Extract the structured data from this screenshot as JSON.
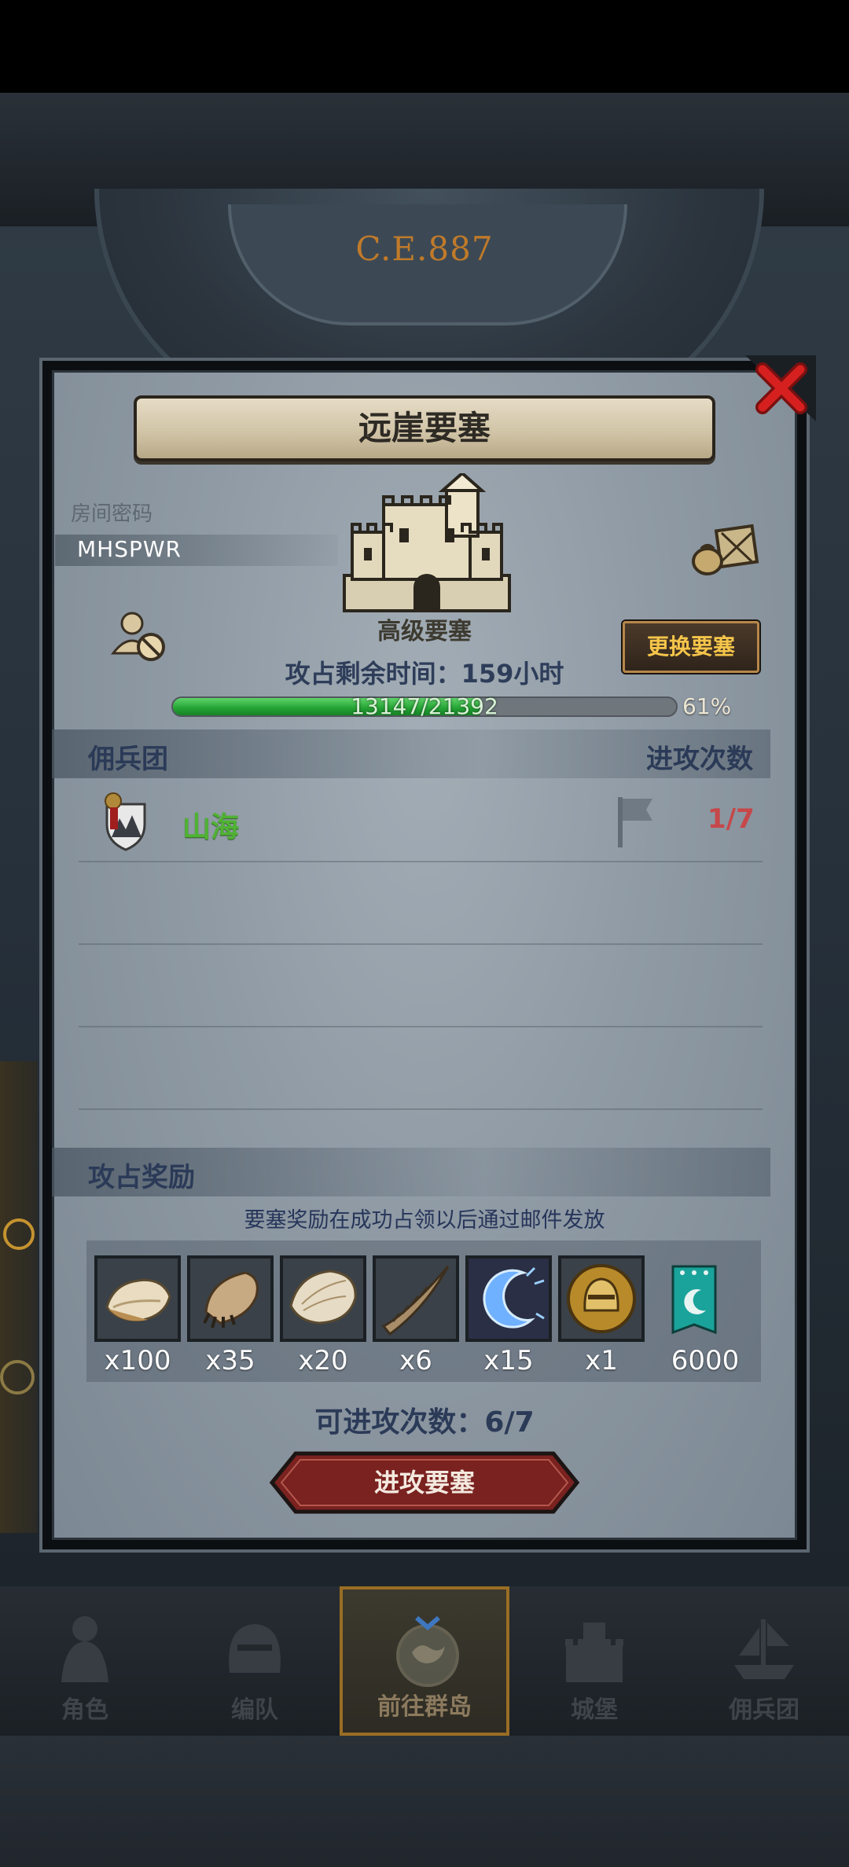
{
  "background": {
    "era_label": "C.E.887"
  },
  "dialog": {
    "title": "远崖要塞",
    "room": {
      "label": "房间密码",
      "code": "MHSPWR"
    },
    "fortress_level": "高级要塞",
    "change_button": "更换要塞",
    "remaining_time": "攻占剩余时间：159小时",
    "progress": {
      "text": "13147/21392",
      "percent_label": "61%",
      "fraction": 0.61
    },
    "mercenary_section": {
      "title": "佣兵团",
      "right_title": "进攻次数"
    },
    "guilds": [
      {
        "name": "山海",
        "attacks": "1/7"
      }
    ],
    "rewards_section": {
      "title": "攻占奖励",
      "note": "要塞奖励在成功占领以后通过邮件发放",
      "items": [
        {
          "icon": "fur-pelt-icon",
          "count": "x100"
        },
        {
          "icon": "claw-pelt-icon",
          "count": "x35"
        },
        {
          "icon": "hide-icon",
          "count": "x20"
        },
        {
          "icon": "horn-icon",
          "count": "x6"
        },
        {
          "icon": "blue-crescent-icon",
          "count": "x15"
        },
        {
          "icon": "golden-helmet-icon",
          "count": "x1"
        },
        {
          "icon": "guild-banner-icon",
          "count": "6000"
        }
      ]
    },
    "attack_quota": "可进攻次数：6/7",
    "attack_button": "进攻要塞"
  },
  "bottom_nav": [
    {
      "label": "角色",
      "icon": "knight-icon",
      "active": false
    },
    {
      "label": "编队",
      "icon": "helmet-icon",
      "active": false
    },
    {
      "label": "前往群岛",
      "icon": "world-map-icon",
      "active": true
    },
    {
      "label": "城堡",
      "icon": "castle-icon",
      "active": false
    },
    {
      "label": "佣兵团",
      "icon": "ship-icon",
      "active": false
    }
  ],
  "colors": {
    "accent_gold": "#f5c54a",
    "progress_green": "#23a233",
    "attack_red": "#c6484a",
    "guild_green": "#4fb233",
    "title_blue": "#2b3a57"
  }
}
